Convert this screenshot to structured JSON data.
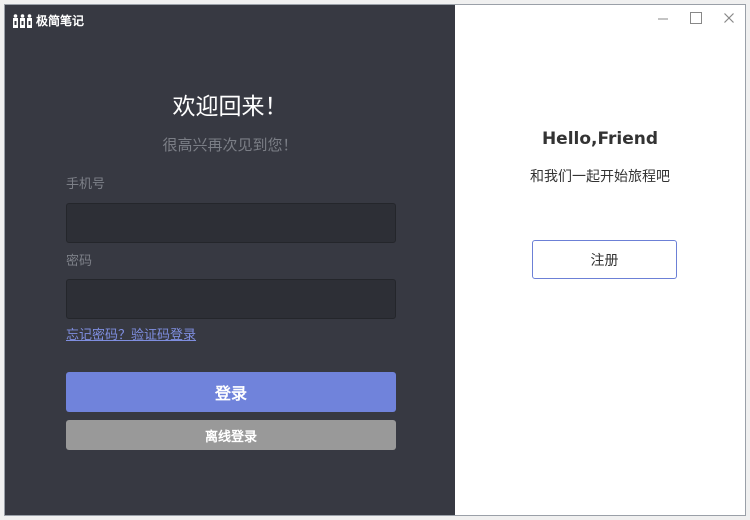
{
  "app": {
    "name": "极简笔记"
  },
  "login": {
    "title": "欢迎回来！",
    "subtitle": "很高兴再次见到您！",
    "phone_label": "手机号",
    "phone_value": "",
    "password_label": "密码",
    "password_value": "",
    "forgot_link": "忘记密码？",
    "sms_login_link": "验证码登录",
    "login_button": "登录",
    "offline_button": "离线登录"
  },
  "signup": {
    "title": "Hello,Friend",
    "subtitle": "和我们一起开始旅程吧",
    "register_button": "注册"
  },
  "window_controls": {
    "minimize_icon": "minimize-icon",
    "maximize_icon": "maximize-icon",
    "close_icon": "close-icon"
  },
  "colors": {
    "left_panel_bg": "#373942",
    "input_bg": "#2d2f36",
    "accent": "#7083db",
    "link": "#7f8ee0",
    "offline_button_bg": "#999999",
    "right_panel_bg": "#ffffff"
  }
}
